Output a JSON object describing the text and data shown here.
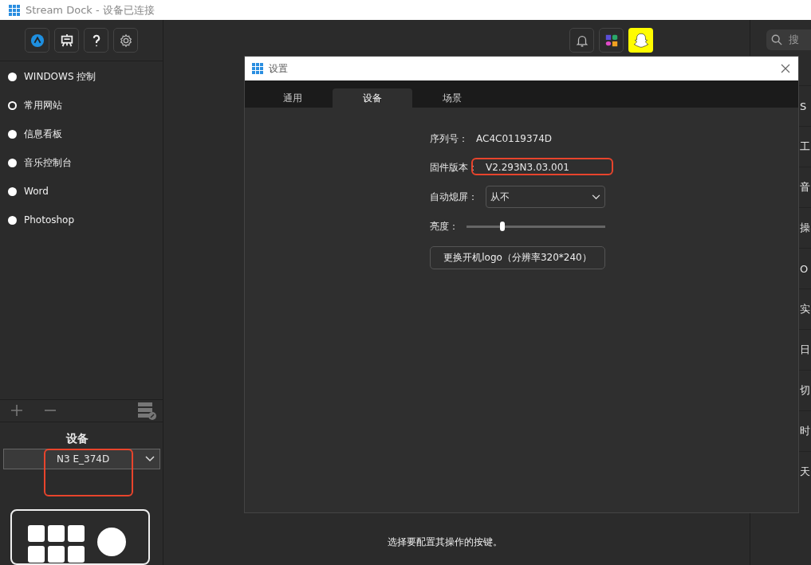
{
  "window": {
    "title": "Stream Dock - 设备已连接"
  },
  "sidebar": {
    "profiles": [
      {
        "label": "WINDOWS 控制",
        "selected": false
      },
      {
        "label": "常用网站",
        "selected": true
      },
      {
        "label": "信息看板",
        "selected": false
      },
      {
        "label": "音乐控制台",
        "selected": false
      },
      {
        "label": "Word",
        "selected": false
      },
      {
        "label": "Photoshop",
        "selected": false
      }
    ],
    "device_label": "设备",
    "device_value": "N3 E_374D"
  },
  "main": {
    "hint": "选择要配置其操作的按键。"
  },
  "right_panel": {
    "search_placeholder": "搜",
    "items": [
      "S",
      "工",
      "音",
      "操",
      "O",
      "实",
      "日",
      "切",
      "时",
      "天"
    ]
  },
  "dialog": {
    "title": "设置",
    "tabs": [
      {
        "label": "通用",
        "selected": false
      },
      {
        "label": "设备",
        "selected": true
      },
      {
        "label": "场景",
        "selected": false
      }
    ],
    "serial_label": "序列号：",
    "serial": "AC4C0119374D",
    "firmware_label": "固件版本：",
    "firmware": "V2.293N3.03.001",
    "sleep_label": "自动熄屏：",
    "sleep_value": "从不",
    "brightness_label": "亮度：",
    "brightness": {
      "level": 0.26
    },
    "logo_button": "更换开机logo（分辨率320*240）"
  }
}
